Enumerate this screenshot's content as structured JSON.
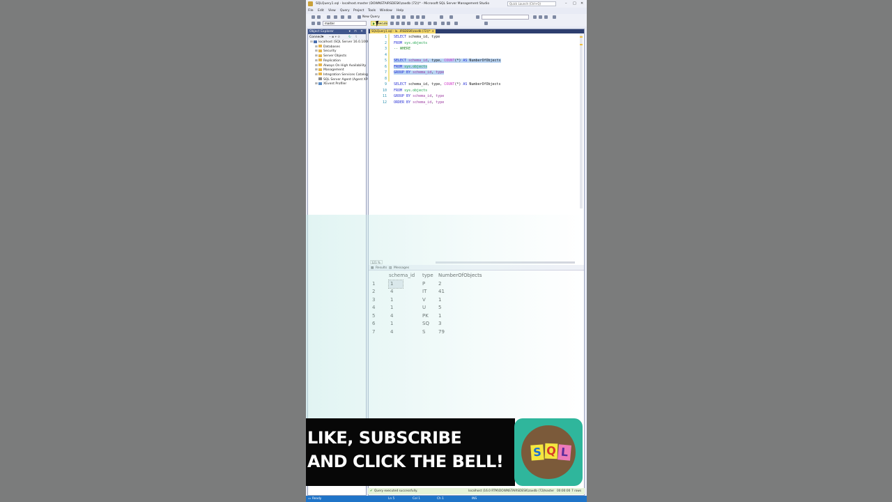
{
  "window": {
    "title": "SQLQuery1.sql - localhost.master (DOWNSTAIRSDESK\\zaxdb (72))* - Microsoft SQL Server Management Studio",
    "quick_launch": "Quick Launch (Ctrl+Q)"
  },
  "menu": [
    "File",
    "Edit",
    "View",
    "Query",
    "Project",
    "Tools",
    "Window",
    "Help"
  ],
  "toolbar": {
    "new_query": "New Query",
    "database": "master",
    "execute": "Execute"
  },
  "object_explorer": {
    "title": "Object Explorer",
    "connect": "Connect",
    "tree": [
      {
        "label": "localhost (SQL Server 16.0.1000.6 - ",
        "icon": "server-icon"
      },
      {
        "label": "Databases",
        "icon": "folder-icon"
      },
      {
        "label": "Security",
        "icon": "folder-icon"
      },
      {
        "label": "Server Objects",
        "icon": "folder-icon"
      },
      {
        "label": "Replication",
        "icon": "folder-icon"
      },
      {
        "label": "Always On High Availability",
        "icon": "folder-icon"
      },
      {
        "label": "Management",
        "icon": "folder-icon"
      },
      {
        "label": "Integration Services Catalogs",
        "icon": "folder-icon"
      },
      {
        "label": "SQL Server Agent (Agent XPs di",
        "icon": "agent-icon"
      },
      {
        "label": "XEvent Profiler",
        "icon": "xevent-icon"
      }
    ]
  },
  "editor": {
    "tab_label": "SQLQuery1.sql - lo...IRSDESK\\zaxdb (72))*",
    "zoom": "121 %",
    "lines": {
      "1": {
        "kw1": "SELECT",
        "rest": " schema_id, type"
      },
      "2": {
        "kw1": "FROM",
        "obj": "sys.objects"
      },
      "3": {
        "comment": "-- WHERE"
      },
      "5": {
        "kw1": "SELECT",
        "id1": "schema_id",
        "t1": ", ",
        "id2": "type",
        "t2": ", ",
        "fn": "COUNT",
        "t3": "(*) ",
        "kw2": "AS",
        "t4": " NumberOfObjects"
      },
      "6": {
        "kw1": "FROM",
        "obj": "sys.objects"
      },
      "7": {
        "kw1": "GROUP BY",
        "id1": "schema_id",
        "t1": ", ",
        "id2": "type"
      },
      "9": {
        "kw1": "SELECT",
        "rest": " schema_id, type, ",
        "fn": "COUNT",
        "t3": "(*) ",
        "kw2": "AS",
        "t4": " NumberOfObjects"
      },
      "10": {
        "kw1": "FROM",
        "obj": "sys.objects"
      },
      "11": {
        "kw1": "GROUP BY",
        "id1": "schema_id",
        "t1": ", ",
        "id2": "type"
      },
      "12": {
        "kw1": "ORDER BY",
        "id1": "schema_id",
        "t1": ", ",
        "id2": "type"
      }
    },
    "line_numbers": [
      "1",
      "2",
      "3",
      "4",
      "5",
      "6",
      "7",
      "8",
      "9",
      "10",
      "11",
      "12"
    ]
  },
  "results": {
    "tabs": [
      "Results",
      "Messages"
    ],
    "columns": [
      "schema_id",
      "type",
      "NumberOfObjects"
    ],
    "rows": [
      [
        "1",
        "1",
        "P",
        "2"
      ],
      [
        "2",
        "4",
        "IT",
        "41"
      ],
      [
        "3",
        "1",
        "V",
        "1"
      ],
      [
        "4",
        "1",
        "U",
        "5"
      ],
      [
        "5",
        "4",
        "PK",
        "1"
      ],
      [
        "6",
        "1",
        "SQ",
        "3"
      ],
      [
        "7",
        "4",
        "S",
        "79"
      ]
    ]
  },
  "query_status": {
    "message": "Query executed successfully.",
    "server": "localhost (16.0 RTM)",
    "user": "DOWNSTAIRSDESK\\zaxdb (72)",
    "database": "master",
    "elapsed": "00:00:00",
    "rows": "7 rows"
  },
  "app_status": {
    "ready": "Ready",
    "ln": "Ln 5",
    "col": "Col 1",
    "ch": "Ch 1",
    "mode": "INS"
  },
  "banner": {
    "line1": "LIKE, SUBSCRIBE",
    "line2": "AND CLICK THE BELL!"
  },
  "logo": {
    "letters": [
      "S",
      "Q",
      "L"
    ]
  }
}
